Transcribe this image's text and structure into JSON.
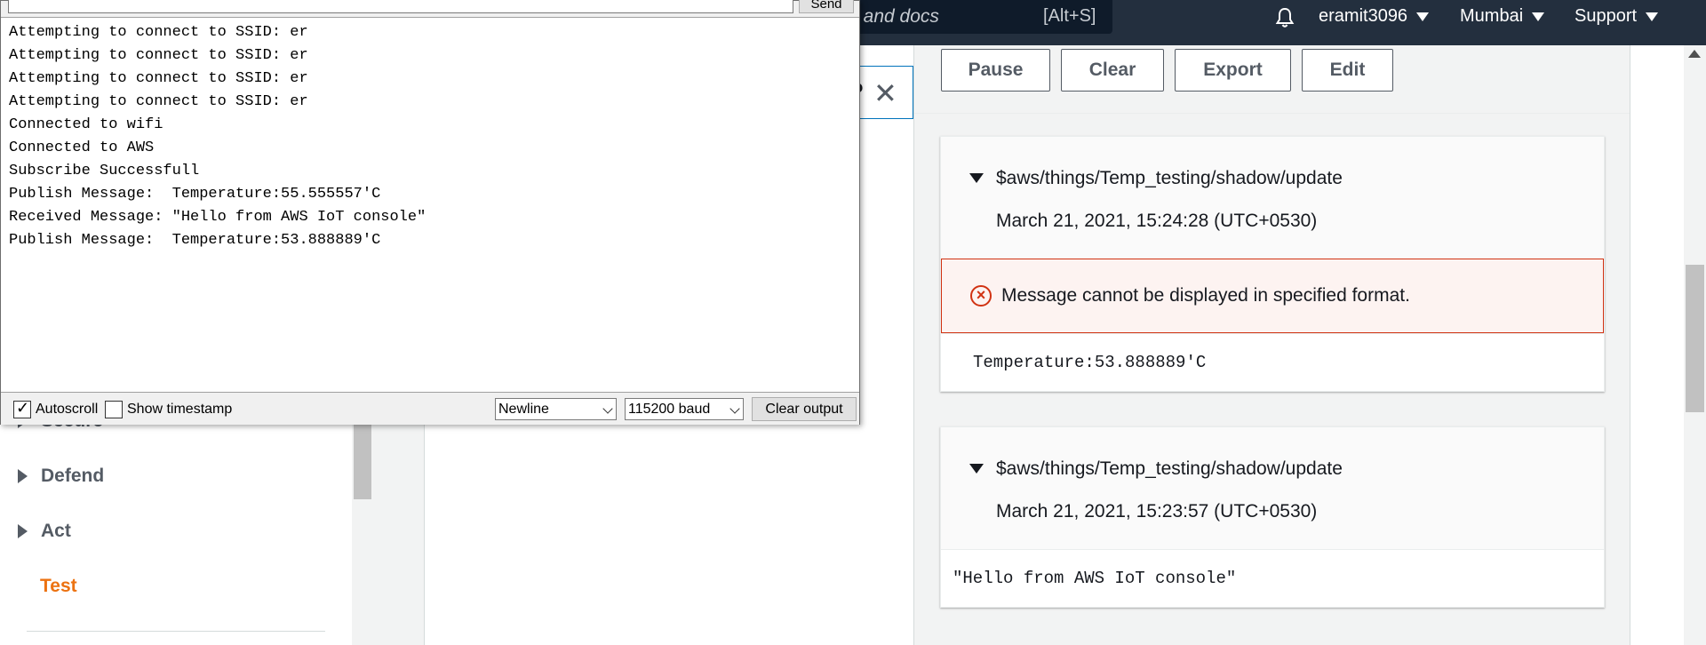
{
  "topbar": {
    "search_placeholder": ", and docs",
    "search_shortcut": "[Alt+S]",
    "bell_icon": "bell-icon",
    "user": "eramit3096",
    "region": "Mumbai",
    "support": "Support"
  },
  "sidebar": {
    "items": [
      {
        "label": "Secure"
      },
      {
        "label": "Defend"
      },
      {
        "label": "Act"
      }
    ],
    "active_item": "Test"
  },
  "test_panel": {
    "toolbar": {
      "pause": "Pause",
      "clear": "Clear",
      "export": "Export",
      "edit": "Edit"
    },
    "messages": [
      {
        "topic": "$aws/things/Temp_testing/shadow/update",
        "timestamp": "March 21, 2021, 15:24:28 (UTC+0530)",
        "error": "Message cannot be displayed in specified format.",
        "payload": "Temperature:53.888889'C"
      },
      {
        "topic": "$aws/things/Temp_testing/shadow/update",
        "timestamp": "March 21, 2021, 15:23:57 (UTC+0530)",
        "payload": "\"Hello from AWS IoT console\""
      }
    ]
  },
  "serial_monitor": {
    "input_value": "",
    "send_label": "Send",
    "lines": [
      "Attempting to connect to SSID: er",
      "Attempting to connect to SSID: er",
      "Attempting to connect to SSID: er",
      "Attempting to connect to SSID: er",
      "Connected to wifi",
      "Connected to AWS",
      "Subscribe Successfull",
      "Publish Message:  Temperature:55.555557'C",
      "Received Message: \"Hello from AWS IoT console\"",
      "Publish Message:  Temperature:53.888889'C"
    ],
    "autoscroll_label": "Autoscroll",
    "autoscroll_checked": true,
    "timestamp_label": "Show timestamp",
    "timestamp_checked": false,
    "line_ending": "Newline",
    "baud": "115200 baud",
    "clear_output_label": "Clear output"
  },
  "colors": {
    "aws_nav_bg": "#232f3e",
    "active_orange": "#ec7211",
    "error_red": "#d13212",
    "error_bg": "#fdf3f1"
  }
}
